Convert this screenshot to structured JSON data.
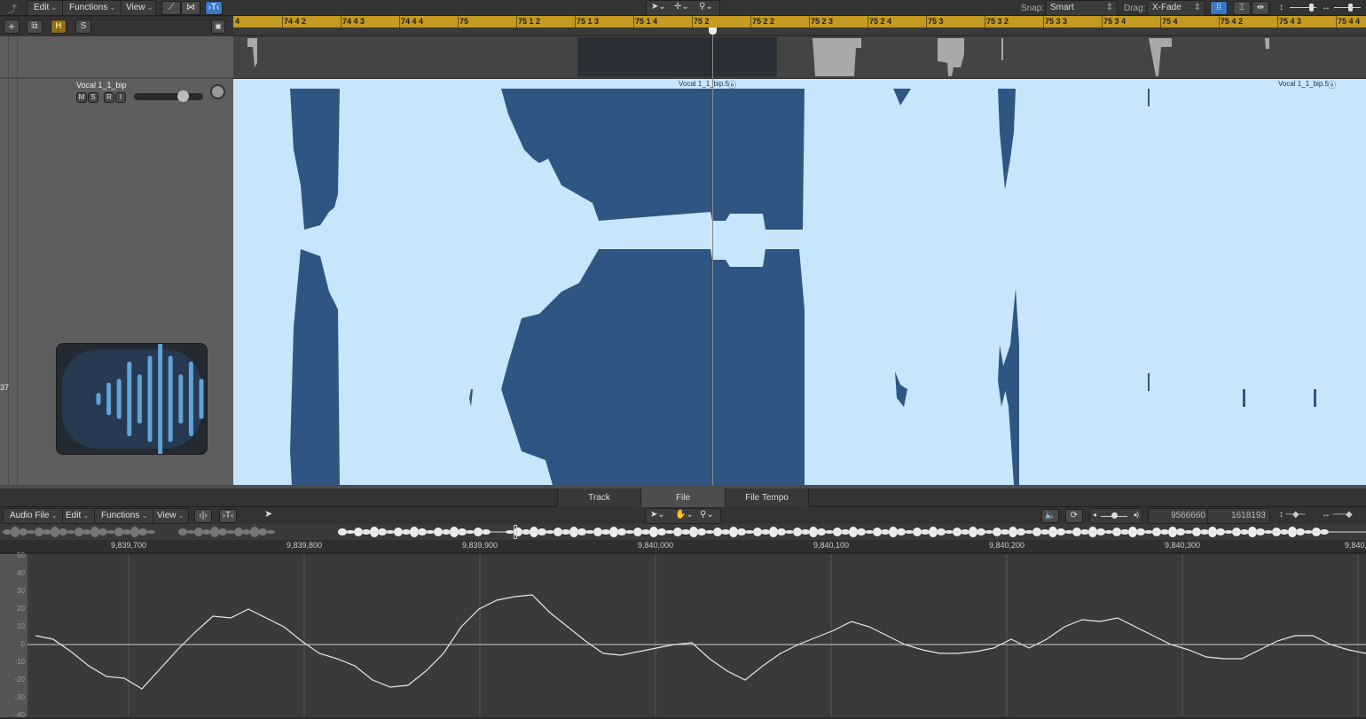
{
  "toolbar": {
    "menus": [
      "Edit",
      "Functions",
      "View"
    ],
    "snap_label": "Snap:",
    "snap_value": "Smart",
    "drag_label": "Drag:",
    "drag_value": "X-Fade"
  },
  "track_header_buttons": {
    "add": "+",
    "h": "H",
    "s": "S"
  },
  "ruler": {
    "labels": [
      "4",
      "74 4 2",
      "74 4 3",
      "74 4 4",
      "75",
      "75 1 2",
      "75 1 3",
      "75 1 4",
      "75 2",
      "75 2 2",
      "75 2 3",
      "75 2 4",
      "75 3",
      "75 3 2",
      "75 3 3",
      "75 3 4",
      "75 4",
      "75 4 2",
      "75 4 3",
      "75 4 4"
    ]
  },
  "track": {
    "name": "Vocal 1_1_bip",
    "buttons": [
      "M",
      "S",
      "R",
      "I"
    ],
    "volume_fraction": 0.75,
    "number": "37"
  },
  "region": {
    "label_1": "Vocal 1_1_bip.5",
    "label_2": "Vocal 1_1_bip.5"
  },
  "bottom_tabs": [
    {
      "label": "Track",
      "active": false
    },
    {
      "label": "File",
      "active": true
    },
    {
      "label": "File Tempo",
      "active": false
    }
  ],
  "editor": {
    "menus": [
      "Audio File",
      "Edit",
      "Functions",
      "View"
    ],
    "readout_1": "9566660",
    "readout_2": "1618193",
    "sample_labels": [
      "9,839,700",
      "9,839,800",
      "9,839,900",
      "9,840,000",
      "9,840,100",
      "9,840,200",
      "9,840,300",
      "9,840,4"
    ],
    "y_labels": [
      "50",
      "40",
      "30",
      "20",
      "10",
      "0",
      "-10",
      "-20",
      "-30",
      "-40"
    ]
  },
  "sample_waveform": {
    "x_range": [
      9839647,
      9840405
    ],
    "ylim": [
      -41,
      51
    ],
    "values": [
      5,
      3,
      -4,
      -12,
      -18,
      -19,
      -25,
      -14,
      -3,
      7,
      16,
      15,
      20,
      15,
      10,
      2,
      -5,
      -8,
      -12,
      -20,
      -24,
      -23,
      -15,
      -5,
      10,
      20,
      25,
      27,
      28,
      18,
      10,
      2,
      -5,
      -6,
      -4,
      -2,
      0,
      1,
      -8,
      -15,
      -20,
      -12,
      -5,
      0,
      4,
      8,
      13,
      10,
      5,
      0,
      -3,
      -5,
      -5,
      -4,
      -2,
      3,
      -2,
      3,
      10,
      14,
      13,
      15,
      10,
      5,
      0,
      -3,
      -7,
      -8,
      -8,
      -3,
      2,
      5,
      5,
      0,
      -3,
      -5
    ]
  },
  "colors": {
    "ruler": "#c49a22",
    "region_bg": "#c7e6fb",
    "waveform": "#2f5683",
    "accent": "#3b78c4"
  }
}
